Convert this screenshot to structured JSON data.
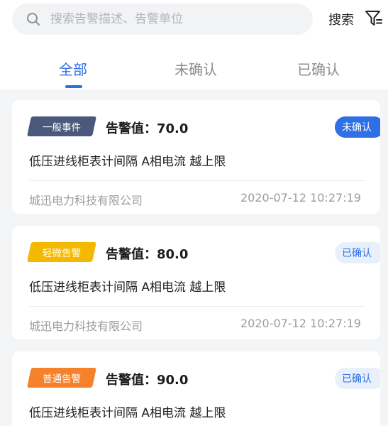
{
  "search": {
    "placeholder": "搜索告警描述、告警单位",
    "button_label": "搜索"
  },
  "tabs": [
    {
      "label": "全部",
      "active": true
    },
    {
      "label": "未确认",
      "active": false
    },
    {
      "label": "已确认",
      "active": false
    }
  ],
  "colors": {
    "accent": "#2f6fe6",
    "badge_general_event": "#4b5a7c",
    "badge_minor": "#f5b800",
    "badge_normal": "#f5822a"
  },
  "alarms": [
    {
      "level": "一般事件",
      "value_label": "告警值：",
      "value": "70.0",
      "status": "未确认",
      "description": "低压进线柜表计间隔 A相电流 越上限",
      "company": "城迅电力科技有限公司",
      "time": "2020-07-12 10:27:19"
    },
    {
      "level": "轻微告警",
      "value_label": "告警值：",
      "value": "80.0",
      "status": "已确认",
      "description": "低压进线柜表计间隔 A相电流 越上限",
      "company": "城迅电力科技有限公司",
      "time": "2020-07-12 10:27:19"
    },
    {
      "level": "普通告警",
      "value_label": "告警值：",
      "value": "90.0",
      "status": "已确认",
      "description": "低压进线柜表计间隔 A相电流 越上限"
    }
  ]
}
